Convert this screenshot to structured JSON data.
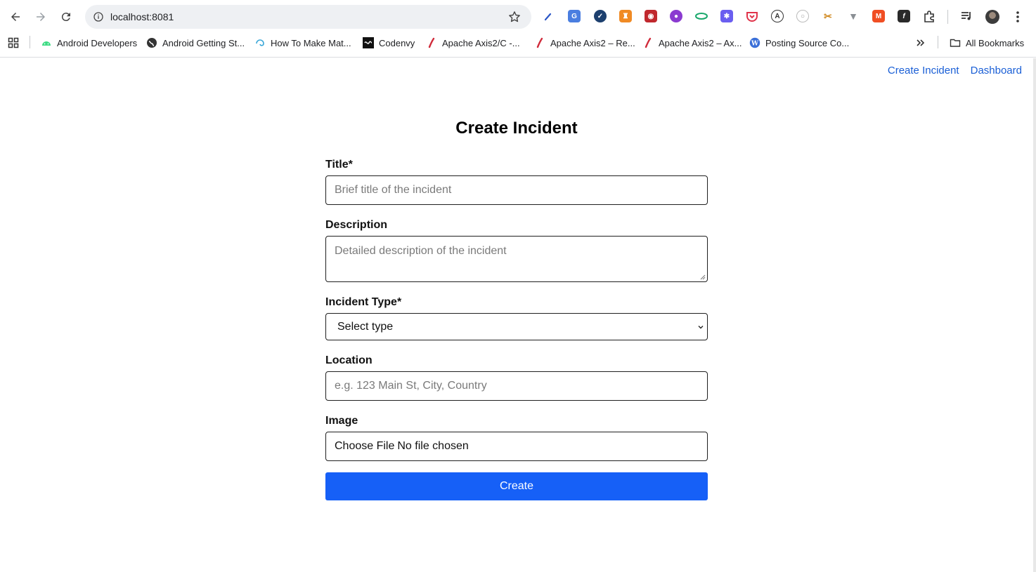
{
  "browser": {
    "url": "localhost:8081",
    "bookmarks": [
      {
        "label": "Android Developers",
        "icon": "android-icon"
      },
      {
        "label": "Android Getting St...",
        "icon": "globe-icon"
      },
      {
        "label": "How To Make Mat...",
        "icon": "swirl-icon"
      },
      {
        "label": "Codenvy",
        "icon": "codenvy-icon"
      },
      {
        "label": "Apache Axis2/C -...",
        "icon": "feather-icon"
      },
      {
        "label": "Apache Axis2 – Re...",
        "icon": "feather-icon"
      },
      {
        "label": "Apache Axis2 – Ax...",
        "icon": "feather-icon"
      },
      {
        "label": "Posting Source Co...",
        "icon": "wordpress-icon"
      }
    ],
    "all_bookmarks": "All Bookmarks"
  },
  "nav": {
    "create_incident": "Create Incident",
    "dashboard": "Dashboard"
  },
  "form": {
    "heading": "Create Incident",
    "title_label": "Title*",
    "title_placeholder": "Brief title of the incident",
    "description_label": "Description",
    "description_placeholder": "Detailed description of the incident",
    "type_label": "Incident Type*",
    "type_selected": "Select type",
    "location_label": "Location",
    "location_placeholder": "e.g. 123 Main St, City, Country",
    "image_label": "Image",
    "file_button": "Choose File",
    "file_status": "No file chosen",
    "submit_label": "Create"
  },
  "colors": {
    "link": "#1a5fd6",
    "primary_button": "#1660f7"
  }
}
